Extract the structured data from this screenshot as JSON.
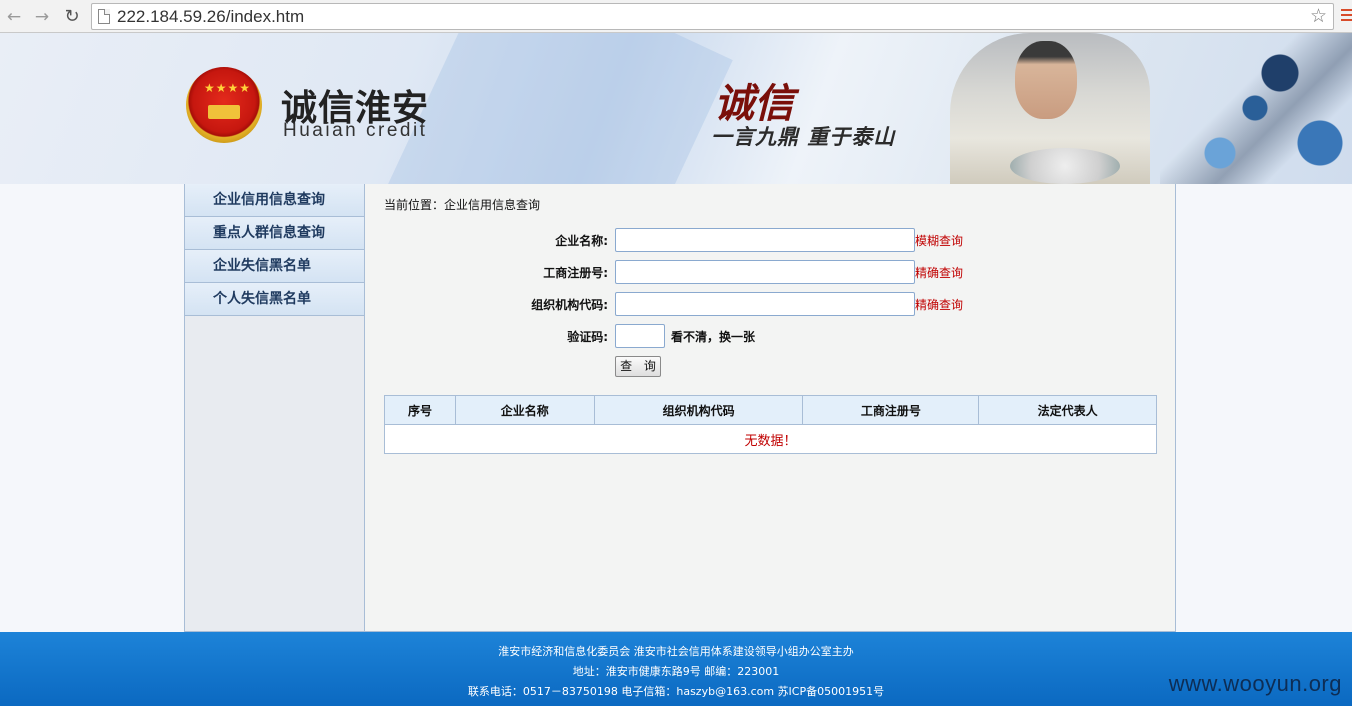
{
  "browser": {
    "url": "222.184.59.26/index.htm"
  },
  "banner": {
    "title": "诚信淮安",
    "subtitle": "Huaian credit",
    "slogan_main": "诚信",
    "slogan_sub": "一言九鼎  重于泰山"
  },
  "sidebar": {
    "items": [
      {
        "label": "企业信用信息查询"
      },
      {
        "label": "重点人群信息查询"
      },
      {
        "label": "企业失信黑名单"
      },
      {
        "label": "个人失信黑名单"
      }
    ]
  },
  "main": {
    "breadcrumb": "当前位置：企业信用信息查询",
    "form": {
      "company_name_label": "企业名称:",
      "company_name_value": "",
      "fuzzy_query": "模糊查询",
      "reg_no_label": "工商注册号:",
      "reg_no_value": "",
      "exact_query_1": "精确查询",
      "org_code_label": "组织机构代码:",
      "org_code_value": "",
      "exact_query_2": "精确查询",
      "captcha_label": "验证码:",
      "captcha_value": "",
      "captcha_refresh": "看不清，换一张",
      "submit_label": "查 询"
    },
    "table": {
      "headers": [
        "序号",
        "企业名称",
        "组织机构代码",
        "工商注册号",
        "法定代表人"
      ],
      "empty_message": "无数据！"
    }
  },
  "footer": {
    "line1": "淮安市经济和信息化委员会  淮安市社会信用体系建设领导小组办公室主办",
    "line2": "地址：淮安市健康东路9号  邮编：223001",
    "line3": "联系电话：0517－83750198 电子信箱：haszyb@163.com 苏ICP备05001951号"
  },
  "watermark": "www.wooyun.org"
}
